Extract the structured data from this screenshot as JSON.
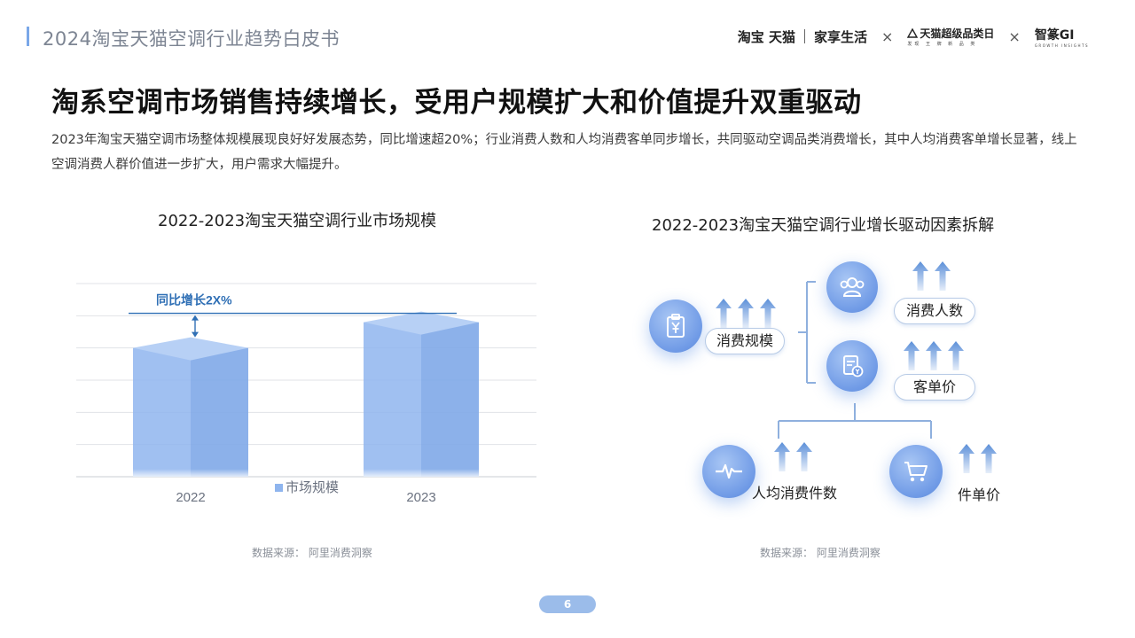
{
  "header": {
    "title": "2024淘宝天猫空调行业趋势白皮书",
    "logos": {
      "taobao_tmall": "淘宝 天猫",
      "home_life": "家享生活",
      "separator_x": "×",
      "tmall_super_category": "天猫超级品类日",
      "tmall_super_category_sub": "发现 王 牌 新 品 类",
      "zhizhuan": "智篆GI",
      "zhizhuan_sub": "GROWTH INSIGHTS"
    }
  },
  "headline": "淘系空调市场销售持续增长，受用户规模扩大和价值提升双重驱动",
  "description": "2023年淘宝天猫空调市场整体规模展现良好好发展态势，同比增速超20%；行业消费人数和人均消费客单同步增长，共同驱动空调品类消费增长，其中人均消费客单增长显著，线上空调消费人群价值进一步扩大，用户需求大幅提升。",
  "left_chart": {
    "title": "2022-2023淘宝天猫空调行业市场规模",
    "source": "数据来源：  阿里消费洞察"
  },
  "right_chart": {
    "title": "2022-2023淘宝天猫空调行业增长驱动因素拆解",
    "source": "数据来源：  阿里消费洞察",
    "nodes": {
      "root": "消费规模",
      "users": "消费人数",
      "aov": "客单价",
      "items_per_user": "人均消费件数",
      "unit_price": "件单价"
    },
    "icons": {
      "root": "clipboard-yuan-icon",
      "users": "users-group-icon",
      "aov": "document-yuan-icon",
      "items_per_user": "pulse-icon",
      "unit_price": "shopping-cart-icon"
    },
    "colors": {
      "circle": "#6f9ae6",
      "arrow": "#5b8fd8",
      "connector": "#8fb0de"
    }
  },
  "chart_data": {
    "type": "bar",
    "categories": [
      "2022",
      "2023"
    ],
    "series": [
      {
        "name": "市场规模",
        "values": [
          100,
          120
        ]
      }
    ],
    "annotation": "同比增长2X%",
    "ylim": [
      0,
      150
    ],
    "grid": true,
    "legend": "bottom-center",
    "colors": {
      "bar": "#8fb5ee",
      "annotation": "#2f6fb5"
    }
  },
  "page_number": "6"
}
